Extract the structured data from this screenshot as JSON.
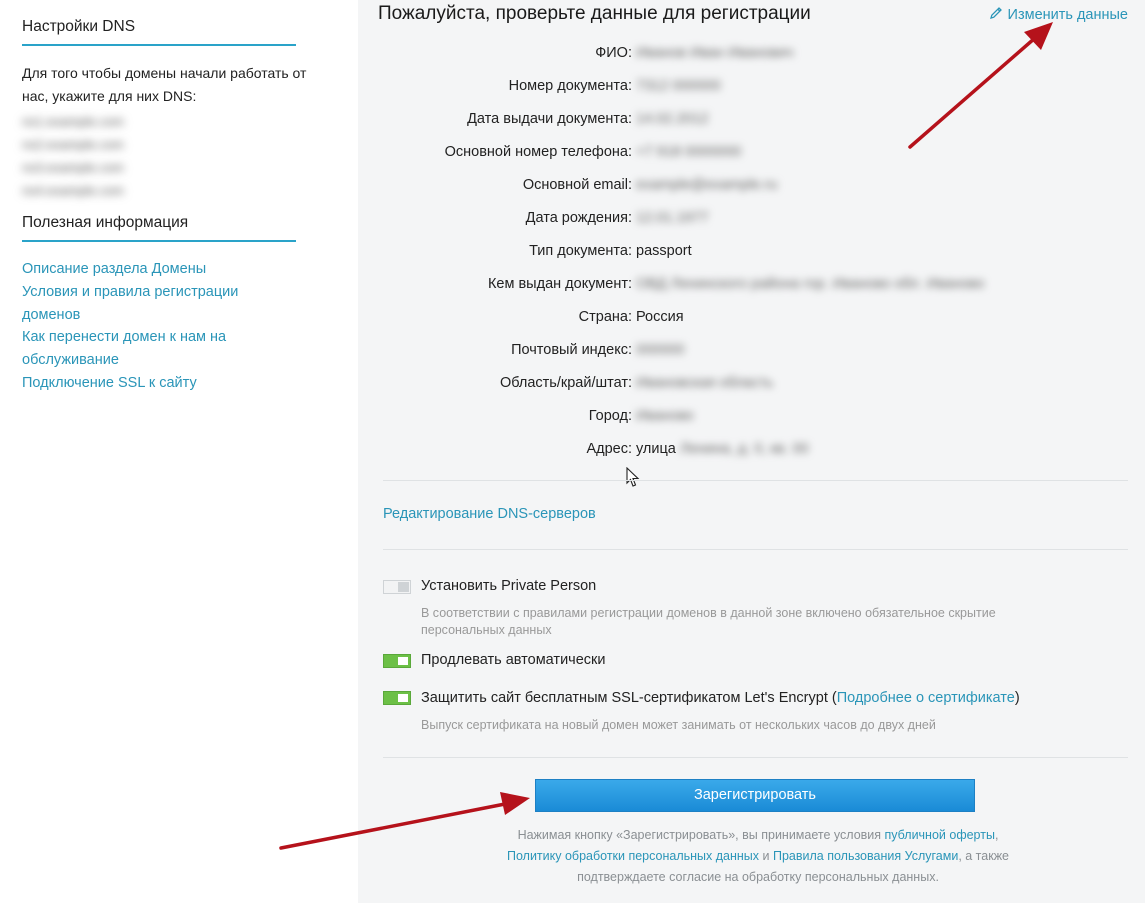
{
  "sidebar": {
    "dns_title": "Настройки DNS",
    "dns_text": "Для того чтобы домены начали работать от нас, укажите для них DNS:",
    "dns_servers": [
      "ns1.example.com",
      "ns2.example.com",
      "ns3.example.com",
      "ns4.example.com"
    ],
    "info_title": "Полезная информация",
    "links": [
      "Описание раздела Домены",
      "Условия и правила регистрации доменов",
      "Как перенести домен к нам на обслуживание",
      "Подключение SSL к сайту"
    ]
  },
  "main": {
    "title": "Пожалуйста, проверьте данные для регистрации",
    "edit_link": "Изменить данные",
    "fields": [
      {
        "label": "ФИО:",
        "value": "Иванов Иван Иванович",
        "blurred": true
      },
      {
        "label": "Номер документа:",
        "value": "7312 000000",
        "blurred": true
      },
      {
        "label": "Дата выдачи документа:",
        "value": "14.02.2012",
        "blurred": true
      },
      {
        "label": "Основной номер телефона:",
        "value": "+7 918 0000000",
        "blurred": true
      },
      {
        "label": "Основной email:",
        "value": "example@example.ru",
        "blurred": true
      },
      {
        "label": "Дата рождения:",
        "value": "12.01.1977",
        "blurred": true
      },
      {
        "label": "Тип документа:",
        "value": "passport",
        "blurred": false
      },
      {
        "label": "Кем выдан документ:",
        "value": "ОВД Ленинского района гор. Иваново обл. Иваново",
        "blurred": true
      },
      {
        "label": "Страна:",
        "value": "Россия",
        "blurred": false
      },
      {
        "label": "Почтовый индекс:",
        "value": "000000",
        "blurred": true
      },
      {
        "label": "Область/край/штат:",
        "value": "Ивановская область",
        "blurred": true
      },
      {
        "label": "Город:",
        "value": "Иваново",
        "blurred": true
      },
      {
        "label": "Адрес:",
        "value": "улица",
        "extra": "Ленина, д. 0, кв. 00",
        "blurred": false
      }
    ],
    "dns_edit_link": "Редактирование DNS-серверов",
    "options": {
      "private_person": {
        "label": "Установить Private Person",
        "hint": "В соответствии с правилами регистрации доменов в данной зоне включено обязательное скрытие персональных данных",
        "enabled": false
      },
      "auto_renew": {
        "label": "Продлевать автоматически",
        "enabled": true
      },
      "ssl": {
        "label_before": "Защитить сайт бесплатным SSL-сертификатом Let's Encrypt (",
        "link": "Подробнее о сертификате",
        "label_after": ")",
        "hint": "Выпуск сертификата на новый домен может занимать от нескольких часов до двух дней",
        "enabled": true
      }
    },
    "register_button": "Зарегистрировать",
    "terms": {
      "part1": "Нажимая кнопку «Зарегистрировать», вы принимаете условия ",
      "link1": "публичной оферты",
      "part2": ",",
      "link2": "Политику обработки персональных данных",
      "part3": " и ",
      "link3": "Правила пользования Услугами",
      "part4": ", а также",
      "part5": "подтверждаете согласие на обработку персональных данных."
    }
  },
  "colors": {
    "accent": "#2a95b8",
    "button": "#2a9be0",
    "toggle_on": "#6cc046",
    "arrow": "#b5121b"
  }
}
